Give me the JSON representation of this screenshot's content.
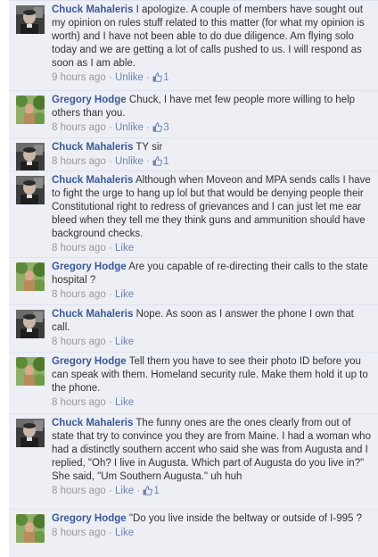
{
  "comments": [
    {
      "author": "Chuck Mahaleris",
      "text": "I apologize. A couple of members have sought out my opinion on rules stuff related to this matter (for what my opinion is worth) and I have not been able to do due diligence. Am flying solo today and we are getting a lot of calls pushed to us. I will respond as soon as I am able.",
      "time": "9 hours ago",
      "action": "Unlike",
      "likes": "1",
      "avatar": "chuck"
    },
    {
      "author": "Gregory Hodge",
      "text": "Chuck, I have met few people more willing to help others than you.",
      "time": "8 hours ago",
      "action": "Unlike",
      "likes": "3",
      "avatar": "gregory"
    },
    {
      "author": "Chuck Mahaleris",
      "text": "TY sir",
      "time": "8 hours ago",
      "action": "Unlike",
      "likes": "1",
      "avatar": "chuck"
    },
    {
      "author": "Chuck Mahaleris",
      "text": "Although when Moveon and MPA sends calls I have to fight the urge to hang up lol but that would be denying people their Constitutional right to redress of grievances and I can just let me ear bleed when they tell me they think guns and ammunition should have background checks.",
      "time": "8 hours ago",
      "action": "Like",
      "likes": "",
      "avatar": "chuck"
    },
    {
      "author": "Gregory Hodge",
      "text": "Are you capable of re-directing their calls to the state hospital ?",
      "time": "8 hours ago",
      "action": "Like",
      "likes": "",
      "avatar": "gregory"
    },
    {
      "author": "Chuck Mahaleris",
      "text": "Nope. As soon as I answer the phone I own that call.",
      "time": "8 hours ago",
      "action": "Like",
      "likes": "",
      "avatar": "chuck"
    },
    {
      "author": "Gregory Hodge",
      "text": "Tell them you have to see their photo ID before you can speak with them. Homeland security rule. Make them hold it up to the phone.",
      "time": "8 hours ago",
      "action": "Like",
      "likes": "",
      "avatar": "gregory"
    },
    {
      "author": "Chuck Mahaleris",
      "text": "The funny ones are the ones clearly from out of state that try to convince you they are from Maine. I had a woman who had a distinctly southern accent who said she was from Augusta and I replied, \"Oh? I live in Augusta. Which part of Augusta do you live in?\" She said, \"Um Southern Augusta.\" uh huh",
      "time": "8 hours ago",
      "action": "Like",
      "likes": "1",
      "avatar": "chuck"
    },
    {
      "author": "Gregory Hodge",
      "text": "\"Do you live inside the beltway or outside of I-995 ?",
      "time": "8 hours ago",
      "action": "Like",
      "likes": "",
      "avatar": "gregory"
    }
  ],
  "separator": "·"
}
